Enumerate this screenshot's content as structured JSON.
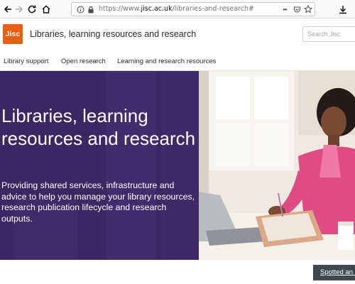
{
  "browser": {
    "url_prefix": "https://www.",
    "url_domain": "jisc.ac.uk",
    "url_path": "/libraries-and-research#",
    "more_glyph": "•••"
  },
  "header": {
    "logo_text": "Jisc",
    "site_title": "Libraries, learning resources and research",
    "search_placeholder": "Search Jisc"
  },
  "nav": {
    "items": [
      {
        "label": "Library support"
      },
      {
        "label": "Open research"
      },
      {
        "label": "Learning and research resources"
      }
    ]
  },
  "hero": {
    "title": "Libraries, learning resources and research",
    "description": "Providing shared services, infrastructure and advice to help you manage your library resources, research publication lifecycle and research outputs.",
    "image_description": "Woman writing in a notebook beside a laptop"
  },
  "feedback": {
    "label": "Spotted an issue?"
  },
  "colors": {
    "brand_orange": "#e85e13",
    "hero_purple": "#3b2763",
    "feedback_bg": "#3e4a4d"
  }
}
